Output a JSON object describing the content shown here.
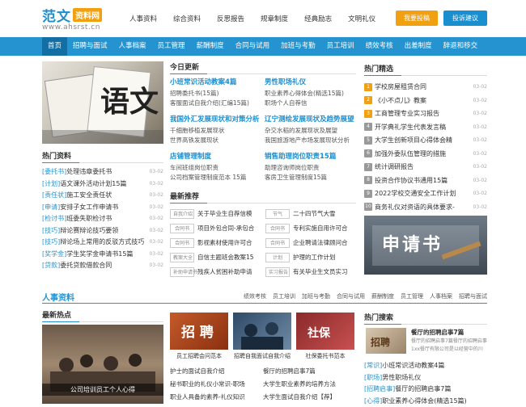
{
  "header": {
    "logo_main": "范文",
    "logo_badge": "资料网",
    "logo_url": "www.ahsrst.cn",
    "nav": [
      "人事资料",
      "综合资料",
      "反思报告",
      "规章制度",
      "经典励志",
      "文明礼仪"
    ],
    "btn_submit": "我要投稿",
    "btn_suggest": "投诉建议"
  },
  "mainnav": [
    "首页",
    "招聘与面试",
    "人事档案",
    "员工管理",
    "薪酬制度",
    "合同与试用",
    "加班与考勤",
    "员工培训",
    "绩效考核",
    "出差制度",
    "辞退和移交"
  ],
  "left": {
    "title": "热门资料",
    "items": [
      {
        "tag": "[委托书]",
        "text": "处理违章委托书",
        "date": "03-02"
      },
      {
        "tag": "[计划]",
        "text": "语文课外活动计划15篇",
        "date": "03-02"
      },
      {
        "tag": "[责任状]",
        "text": "施工安全责任状",
        "date": "03-02"
      },
      {
        "tag": "[申请]",
        "text": "安排子女工作申请书",
        "date": "03-02"
      },
      {
        "tag": "[检讨书]",
        "text": "班委失职检讨书",
        "date": "03-02"
      },
      {
        "tag": "[技巧]",
        "text": "辩论赛辩论技巧要领",
        "date": "03-02"
      },
      {
        "tag": "[技巧]",
        "text": "辩论场上常用的反驳方式技巧",
        "date": "03-02"
      },
      {
        "tag": "[奖学金]",
        "text": "学生奖学金申请书15篇",
        "date": "03-02"
      },
      {
        "tag": "[贷款]",
        "text": "委托贷款借款合同",
        "date": "03-02"
      }
    ]
  },
  "mid": {
    "title": "今日更新",
    "blocks": [
      {
        "h": "小班常识活动教案4篇",
        "s": [
          "招聘委托书(15篇)",
          "客服面试自我介绍(汇编15篇)"
        ]
      },
      {
        "h": "男性职场礼仪",
        "s": [
          "职业素养心得体会(精选15篇)",
          "职场个人自荐信"
        ]
      },
      {
        "h": "我国外汇发展现状和对策分析",
        "s": [
          "千细胞移植发展现状",
          "世界高铁发展现状"
        ]
      },
      {
        "h": "辽宁测绘发展现状及趋势展望",
        "s": [
          "杂交水稻的发展现状及展望",
          "我国旅游地产市场发展现状分析"
        ]
      },
      {
        "h": "店铺管理制度",
        "s": [
          "车间班组岗位职责",
          "公司档案管理制度范本 15篇"
        ]
      },
      {
        "h": "销售助理岗位职责15篇",
        "s": [
          "助理咨询师岗位职责",
          "客房卫生管理制度15篇"
        ]
      }
    ],
    "rec_title": "最新推荐",
    "rec": [
      {
        "tag": "自我介绍",
        "text": "关于毕业生自荐信模",
        "tag2": "节气",
        "text2": "二十四节气大雪"
      },
      {
        "tag": "合同书",
        "text": "项目外包合同-承包合",
        "tag2": "合同书",
        "text2": "专利实施自用许可合"
      },
      {
        "tag": "合同书",
        "text": "影视素材使用许可合",
        "tag2": "合同书",
        "text2": "企业聘请法律顾问合"
      },
      {
        "tag": "教案大全",
        "text": "自信主题班会教案15",
        "tag2": "计划",
        "text2": "护理的工作计划"
      },
      {
        "tag": "补助申请书",
        "text": "残疾人贫困补助申请",
        "tag2": "实习报告",
        "text2": "有关毕业生文员实习"
      }
    ]
  },
  "right": {
    "title": "热门精选",
    "items": [
      {
        "n": "1",
        "text": "学校房屋租赁合同",
        "date": "03-02"
      },
      {
        "n": "2",
        "text": "《小不点儿》教案",
        "date": "03-02"
      },
      {
        "n": "3",
        "text": "工商管理专业实习报告",
        "date": "03-02"
      },
      {
        "n": "4",
        "text": "开学典礼学生代表发言稿",
        "date": "03-02"
      },
      {
        "n": "5",
        "text": "大学生创新项目心得体会精",
        "date": "03-02"
      },
      {
        "n": "6",
        "text": "加强外委队伍管理的措施",
        "date": "03-02"
      },
      {
        "n": "7",
        "text": "统计调研报告",
        "date": "03-02"
      },
      {
        "n": "8",
        "text": "投资合作协议书通用15篇",
        "date": "03-02"
      },
      {
        "n": "9",
        "text": "2022学校交通安全工作计划",
        "date": "03-02"
      },
      {
        "n": "10",
        "text": "商务礼仪对资语的具体要求-",
        "date": "03-02"
      }
    ],
    "banner": "申请书"
  },
  "section2": {
    "title": "人事资料",
    "links": [
      "绩效考核",
      "员工培训",
      "加班与考勤",
      "合同与试用",
      "薪酬制度",
      "员工管理",
      "人事档案",
      "招聘与面试"
    ],
    "left_title": "最新热点",
    "left_cap": "公司培训员工个人心得",
    "thumbs": [
      "员工招聘会问范本",
      "招聘自我面试自我介绍",
      "社保委托书范本"
    ],
    "list_a": [
      "护士的面试自我介绍",
      "秘书职业的礼仪小常识-职场",
      "职业人具备的素养-礼仪知识"
    ],
    "list_b": [
      "餐厅的招聘启事7篇",
      "大学生职业素养的培养方法",
      "大学生面试自我介绍【荐】"
    ],
    "right_title": "热门搜索",
    "right_feature": "餐厅的招聘启事7篇",
    "right_feature_desc": "餐厅的招聘启事7篇餐厅的招聘启事1xx餐厅有限公司是以经营中的川菜为主营",
    "right_items": [
      {
        "tag": "[常识]",
        "text": "小班常识活动教案4篇"
      },
      {
        "tag": "[职场]",
        "text": "男性职场礼仪"
      },
      {
        "tag": "[招聘启事]",
        "text": "餐厅的招聘启事7篇"
      },
      {
        "tag": "[心得]",
        "text": "职业素养心得体会(精选15篇)"
      }
    ]
  }
}
